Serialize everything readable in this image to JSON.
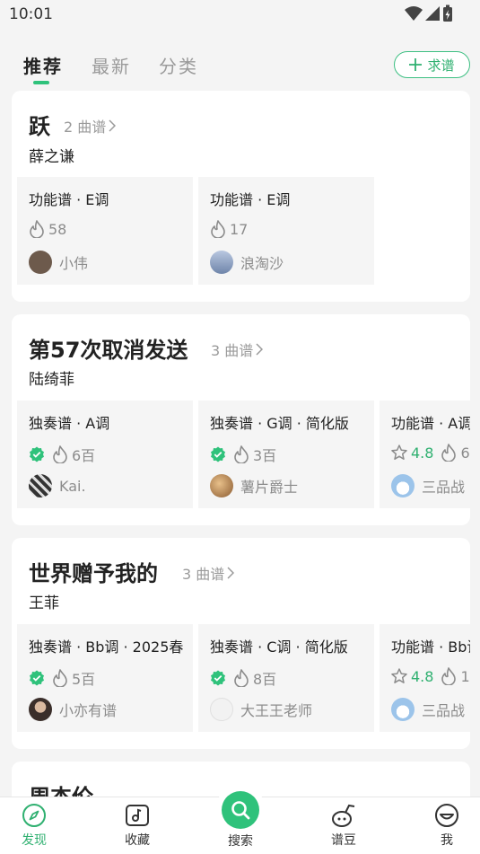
{
  "status_bar": {
    "time": "10:01"
  },
  "tabs": [
    {
      "label": "推荐",
      "active": true
    },
    {
      "label": "最新",
      "active": false
    },
    {
      "label": "分类",
      "active": false
    }
  ],
  "request_button": {
    "label": "求谱"
  },
  "songs": [
    {
      "title": "跃",
      "count": "2 曲谱",
      "artist": "薛之谦",
      "sheets": [
        {
          "type": "功能谱 · E调",
          "verified": false,
          "rating": "",
          "hot": "58",
          "uploader": "小伟",
          "avatar_color": "#6d5a4c"
        },
        {
          "type": "功能谱 · E调",
          "verified": false,
          "rating": "",
          "hot": "17",
          "uploader": "浪淘沙",
          "avatar_color": "#8ea2c6"
        }
      ]
    },
    {
      "title": "第57次取消发送",
      "count": "3 曲谱",
      "artist": "陆绮菲",
      "sheets": [
        {
          "type": "独奏谱 · A调",
          "verified": true,
          "rating": "",
          "hot": "6百",
          "uploader": "Kai.",
          "avatar_color": "#444444"
        },
        {
          "type": "独奏谱 · G调 · 简化版",
          "verified": true,
          "rating": "",
          "hot": "3百",
          "uploader": "薯片爵士",
          "avatar_color": "#b07d52"
        },
        {
          "type": "功能谱 · A调",
          "verified": false,
          "rating": "4.8",
          "hot": "6",
          "uploader": "三品战",
          "avatar_color": "#9cc4ea"
        }
      ]
    },
    {
      "title": "世界赠予我的",
      "count": "3 曲谱",
      "artist": "王菲",
      "sheets": [
        {
          "type": "独奏谱 · Bb调 · 2025春",
          "verified": true,
          "rating": "",
          "hot": "5百",
          "uploader": "小亦有谱",
          "avatar_color": "#4a3c36"
        },
        {
          "type": "独奏谱 · C调 · 简化版",
          "verified": true,
          "rating": "",
          "hot": "8百",
          "uploader": "大王王老师",
          "avatar_color": "#f2f2f2"
        },
        {
          "type": "功能谱 · Bb调",
          "verified": false,
          "rating": "4.8",
          "hot": "1",
          "uploader": "三品战",
          "avatar_color": "#9cc4ea"
        }
      ]
    },
    {
      "title": "周杰伦",
      "count": "",
      "artist": "",
      "sheets": []
    }
  ],
  "bottom_nav": [
    {
      "label": "发现",
      "icon": "compass-icon",
      "active": true
    },
    {
      "label": "收藏",
      "icon": "music-note-icon",
      "active": false
    },
    {
      "label": "搜索",
      "icon": "search-icon",
      "active": false
    },
    {
      "label": "谱豆",
      "icon": "bean-icon",
      "active": false
    },
    {
      "label": "我",
      "icon": "face-icon",
      "active": false
    }
  ],
  "colors": {
    "accent": "#2fc27b",
    "background": "#f4f4f4"
  }
}
